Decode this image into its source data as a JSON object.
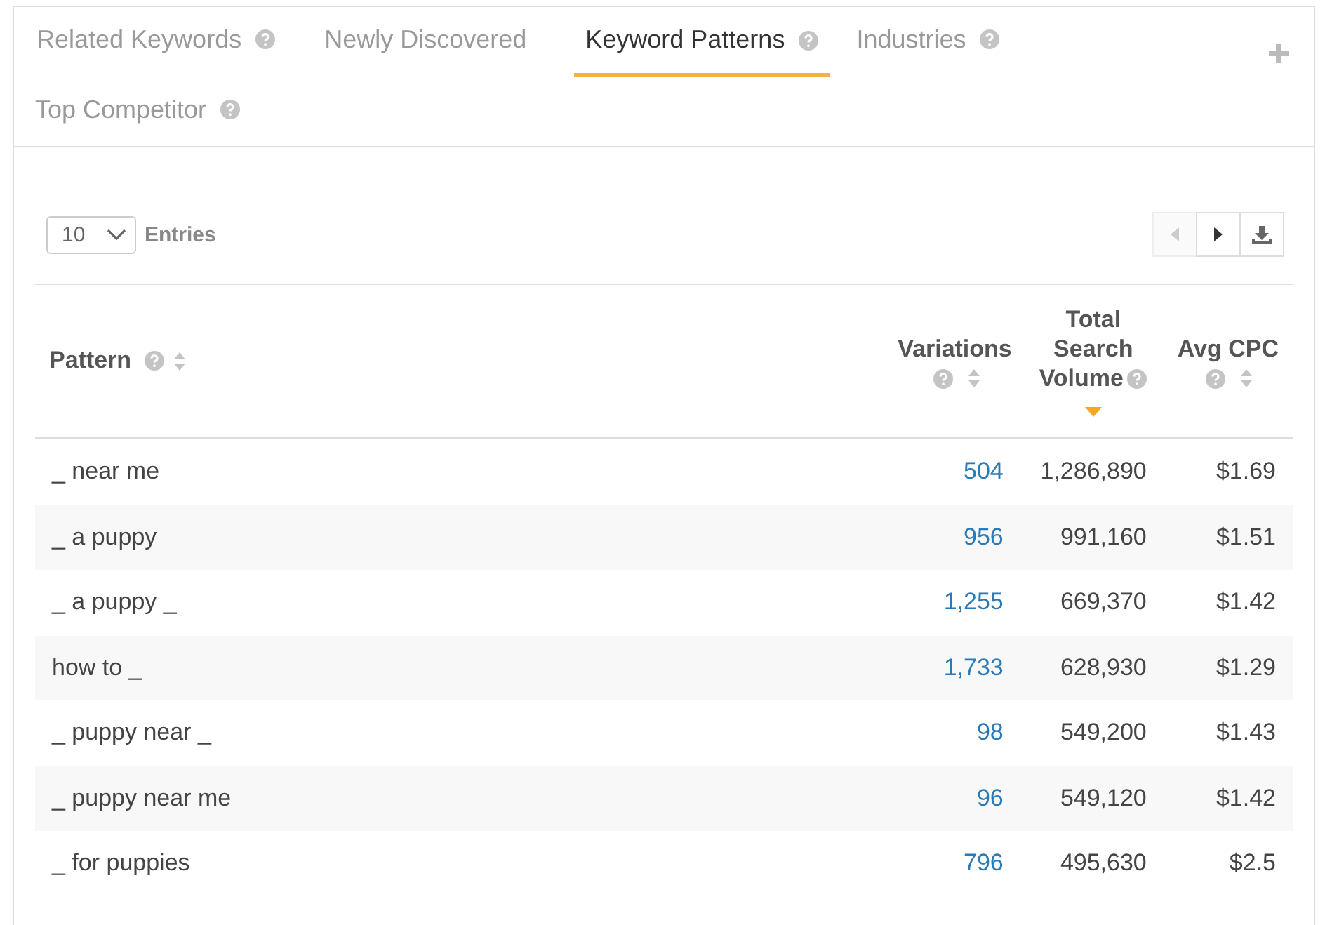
{
  "tabs": [
    {
      "label": "Related Keywords",
      "help": true,
      "selected": false
    },
    {
      "label": "Newly Discovered",
      "help": false,
      "selected": false
    },
    {
      "label": "Keyword Patterns",
      "help": true,
      "selected": true
    },
    {
      "label": "Industries",
      "help": true,
      "selected": false
    },
    {
      "label": "Top Competitor",
      "help": true,
      "selected": false
    }
  ],
  "entries": {
    "value": "10",
    "label": "Entries"
  },
  "pagination": {
    "prev_disabled": true,
    "next_disabled": false
  },
  "table": {
    "columns": [
      {
        "label": "Pattern",
        "sorted": false
      },
      {
        "label": "Variations",
        "sorted": false
      },
      {
        "label": "Total Search Volume",
        "sorted": true
      },
      {
        "label": "Avg CPC",
        "sorted": false
      }
    ],
    "rows": [
      [
        "_ near me",
        "504",
        "1,286,890",
        "$1.69"
      ],
      [
        "_ a puppy",
        "956",
        "991,160",
        "$1.51"
      ],
      [
        "_ a puppy _",
        "1,255",
        "669,370",
        "$1.42"
      ],
      [
        "how to _",
        "1,733",
        "628,930",
        "$1.29"
      ],
      [
        "_ puppy near _",
        "98",
        "549,200",
        "$1.43"
      ],
      [
        "_ puppy near me",
        "96",
        "549,120",
        "$1.42"
      ],
      [
        "_ for puppies",
        "796",
        "495,630",
        "$2.5"
      ]
    ]
  }
}
